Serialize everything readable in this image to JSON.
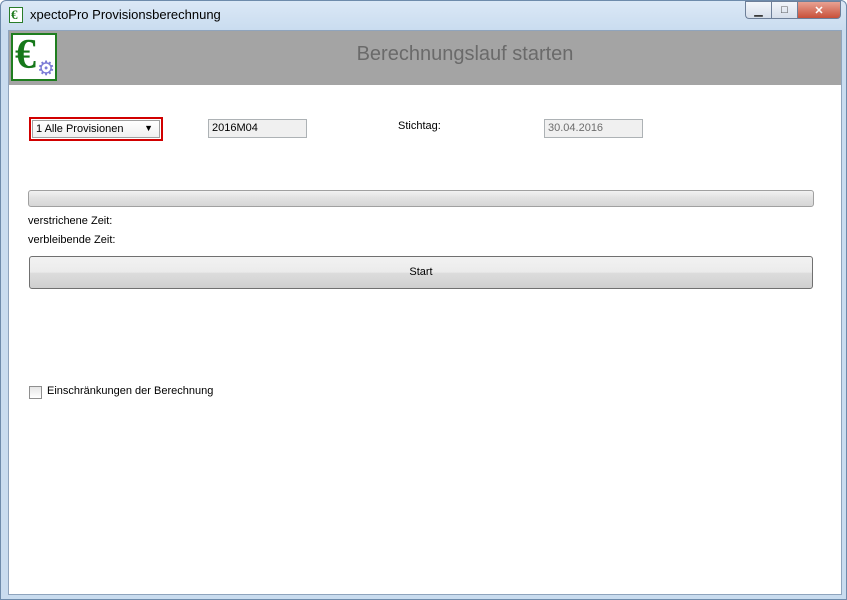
{
  "window": {
    "title": "xpectoPro Provisionsberechnung"
  },
  "caption_buttons": {
    "minimize": "▭",
    "maximize": "□",
    "close": "✕"
  },
  "header": {
    "title": "Berechnungslauf starten",
    "logo_icon": "euro-gear-icon"
  },
  "form": {
    "selection_value": "1 Alle Provisionen",
    "period_value": "2016M04",
    "stichtag_label": "Stichtag:",
    "stichtag_value": "30.04.2016"
  },
  "progress": {
    "value": 0
  },
  "status": {
    "elapsed_label": "verstrichene Zeit:",
    "remaining_label": "verbleibende Zeit:"
  },
  "start_button": {
    "label": "Start"
  },
  "restrictions": {
    "label": "Einschränkungen der Berechnung",
    "checked": false
  },
  "colors": {
    "header_bg": "#a4a4a4",
    "highlight_border": "#d10000",
    "logo_green": "#16781a"
  }
}
